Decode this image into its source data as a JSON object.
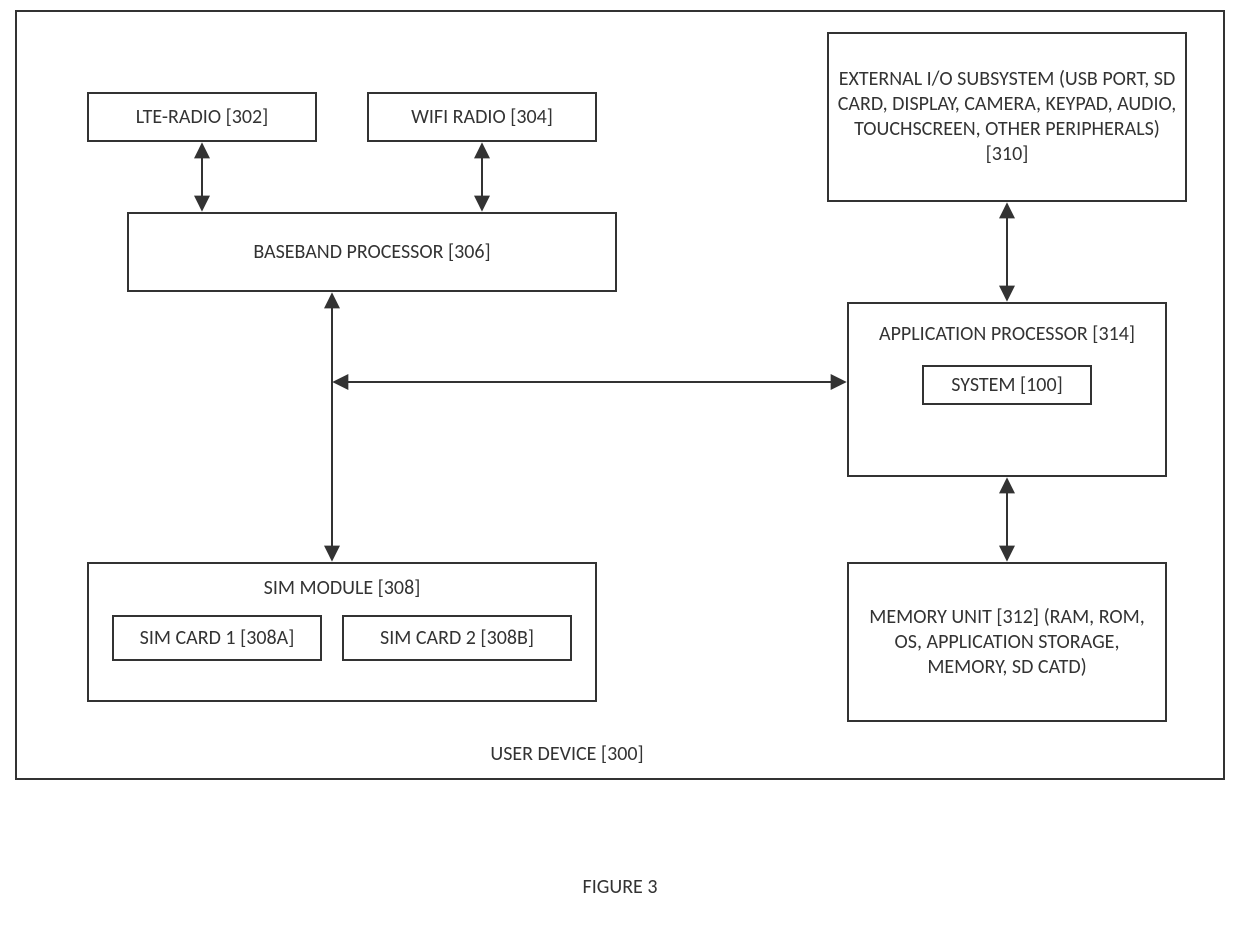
{
  "blocks": {
    "lte_radio": "LTE-RADIO [302]",
    "wifi_radio": "WIFI RADIO [304]",
    "baseband": "BASEBAND PROCESSOR [306]",
    "sim_module": "SIM MODULE [308]",
    "sim_card_1": "SIM CARD 1 [308A]",
    "sim_card_2": "SIM CARD 2 [308B]",
    "external_io": "EXTERNAL I/O SUBSYSTEM (USB PORT, SD CARD, DISPLAY, CAMERA, KEYPAD, AUDIO, TOUCHSCREEN, OTHER PERIPHERALS) [310]",
    "app_processor": "APPLICATION PROCESSOR [314]",
    "system": "SYSTEM [100]",
    "memory_unit": "MEMORY UNIT [312] (RAM, ROM, OS, APPLICATION STORAGE, MEMORY, SD CATD)"
  },
  "captions": {
    "device": "USER DEVICE [300]",
    "figure": "FIGURE 3"
  }
}
